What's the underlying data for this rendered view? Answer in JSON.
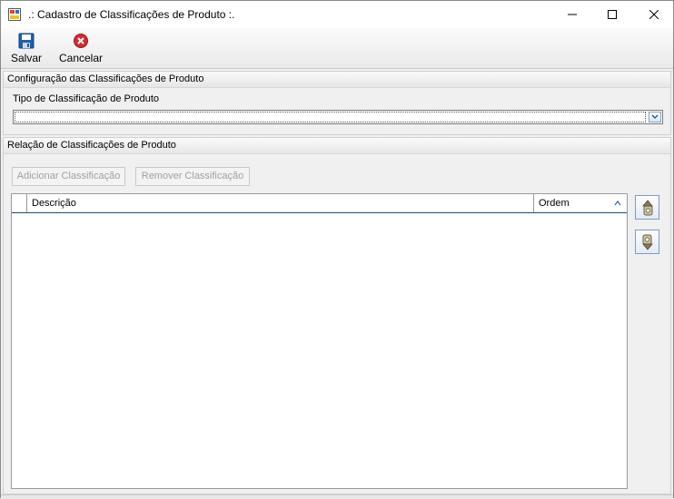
{
  "window": {
    "title": ".: Cadastro de Classificações de Produto :.",
    "icon": "form-icon",
    "controls": [
      "minimize-icon",
      "maximize-icon",
      "close-icon"
    ]
  },
  "toolbar": {
    "save_label": "Salvar",
    "save_icon": "floppy-disk-icon",
    "cancel_label": "Cancelar",
    "cancel_icon": "cancel-x-icon"
  },
  "config_group": {
    "header": "Configuração das Classificações de Produto",
    "tipo_label": "Tipo de Classificação de Produto",
    "tipo_value": ""
  },
  "relation_group": {
    "header": "Relação de Classificações de Produto",
    "add_button": "Adicionar Classificação",
    "remove_button": "Remover Classificação",
    "columns": [
      "Descrição",
      "Ordem"
    ],
    "sorted_column": "Ordem",
    "rows": [],
    "side_buttons": [
      "move-up-icon",
      "move-down-icon"
    ]
  },
  "colors": {
    "cancel_red": "#d62b2b",
    "save_blue": "#1f5fae",
    "grid_header_line": "#1f4a7a"
  }
}
